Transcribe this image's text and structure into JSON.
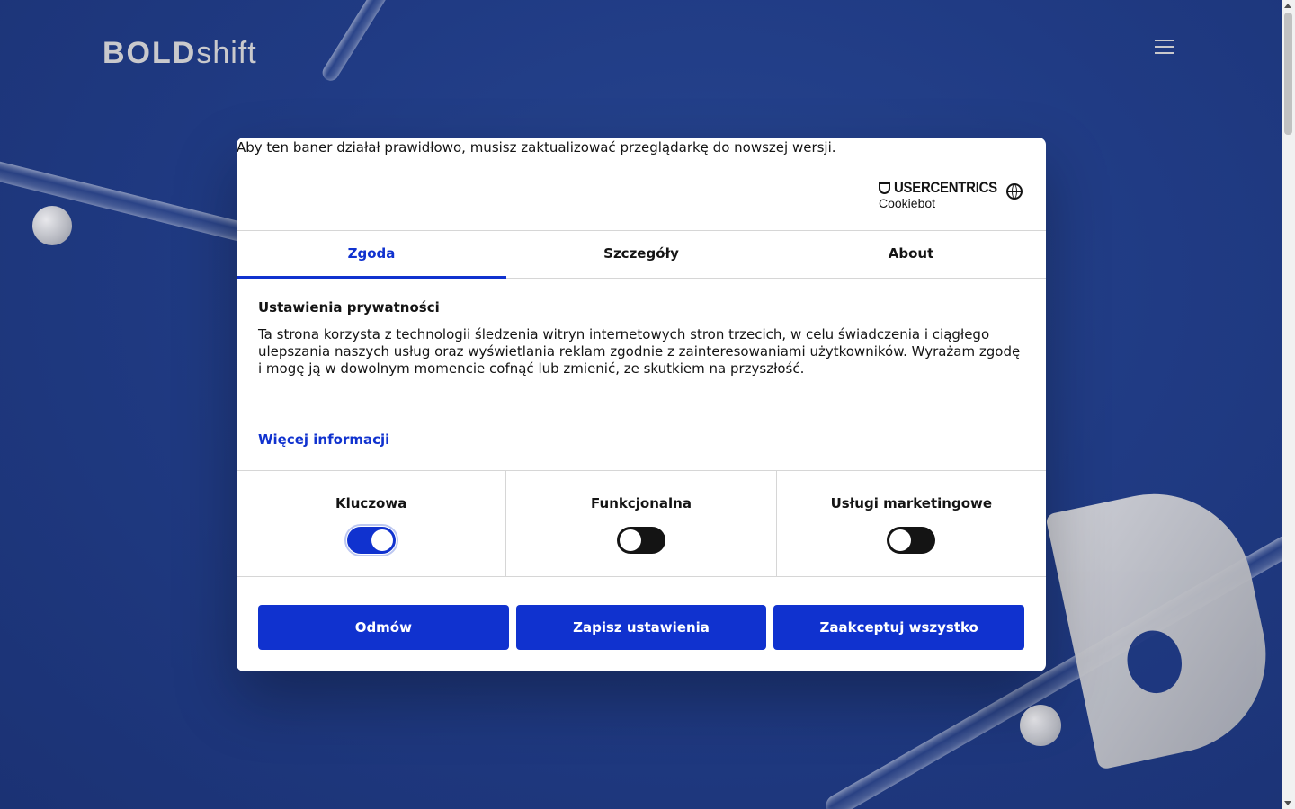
{
  "site": {
    "logo_bold": "BOLD",
    "logo_light": "shift"
  },
  "banner": {
    "browser_notice": "Aby ten baner działał prawidłowo, musisz zaktualizować przeglądarkę do nowszej wersji.",
    "brand_name": "USERCENTRICS",
    "brand_sub": "Cookiebot",
    "tabs": [
      {
        "label": "Zgoda",
        "active": true
      },
      {
        "label": "Szczegóły",
        "active": false
      },
      {
        "label": "About",
        "active": false
      }
    ],
    "heading": "Ustawienia prywatności",
    "body": "Ta strona korzysta z technologii śledzenia witryn internetowych stron trzecich, w celu świadczenia i ciągłego ulepszania naszych usług oraz wyświetlania reklam zgodnie z zainteresowaniami użytkowników. Wyrażam zgodę i mogę ją w dowolnym momencie cofnąć lub zmienić, ze skutkiem na przyszłość.",
    "more_info": "Więcej informacji",
    "toggles": [
      {
        "label": "Kluczowa",
        "on": true
      },
      {
        "label": "Funkcjonalna",
        "on": false
      },
      {
        "label": "Usługi marketingowe",
        "on": false
      }
    ],
    "buttons": {
      "deny": "Odmów",
      "save": "Zapisz ustawienia",
      "accept_all": "Zaakceptuj wszystko"
    }
  },
  "colors": {
    "accent": "#1032cf",
    "background": "#203b84"
  },
  "icons": [
    "hamburger-menu-icon",
    "globe-icon",
    "usercentrics-shield-icon"
  ]
}
